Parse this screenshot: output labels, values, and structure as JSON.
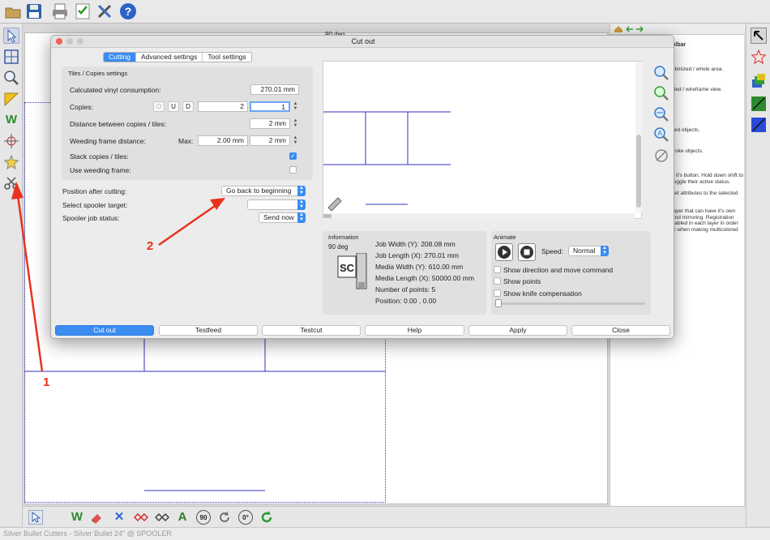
{
  "toolbar": {
    "buttons": [
      "open-icon",
      "save-icon",
      "print-icon",
      "checklist-icon",
      "tools-icon",
      "help-icon"
    ]
  },
  "canvas_label": "90 deg",
  "helppanel": {
    "heading": "olbar",
    "lines": [
      "ptimized / whole area.",
      "illed / wireframe view.",
      "lled objects.",
      "troke objects.",
      "s it's button. Hold down shift to toggle their active status.",
      "set attributes to the selected",
      "layer that can have it's own and mirroring. Registration sabled in each layer in order ic when making multicolored"
    ]
  },
  "dialog": {
    "title": "Cut out",
    "tabs": [
      {
        "label": "Cutting",
        "selected": true
      },
      {
        "label": "Advanced settings",
        "selected": false
      },
      {
        "label": "Tool settings",
        "selected": false
      }
    ],
    "tiles": {
      "heading": "Tiles / Copies settings",
      "consumption_label": "Calculated vinyl consumption:",
      "consumption_value": "270.01 mm",
      "copies_label": "Copies:",
      "copies_buttons": [
        "O",
        "U",
        "D"
      ],
      "copies_x": "2",
      "copies_y": "1",
      "distance_label": "Distance between copies / tiles:",
      "distance_value": "2 mm",
      "weeding_label": "Weeding frame distance:",
      "weeding_max_label": "Max:",
      "weeding_max_value": "2.00 mm",
      "weeding_value": "2 mm",
      "stack_label": "Stack copies / tiles:",
      "stack_checked": true,
      "useweed_label": "Use weeding frame:",
      "useweed_checked": false
    },
    "position_label": "Position after cutting:",
    "position_value": "Go back to beginning",
    "spooler_label": "Select spooler target:",
    "spooler_value": "",
    "jobstatus_label": "Spooler job status:",
    "jobstatus_value": "Send now",
    "information": {
      "heading": "Information",
      "rotation": "90 deg",
      "logo": "SC",
      "lines": [
        "Job Width (Y): 208.08 mm",
        "Job Length (X): 270.01 mm",
        "Media Width (Y): 610.00 mm",
        "Media Length (X): 50000.00 mm",
        "Number of points: 5",
        "Position: 0.00 , 0.00"
      ]
    },
    "animate": {
      "heading": "Animate",
      "speed_label": "Speed:",
      "speed_value": "Normal",
      "options": [
        {
          "label": "Show direction and move command",
          "checked": false
        },
        {
          "label": "Show points",
          "checked": false
        },
        {
          "label": "Show knife compensation",
          "checked": false
        }
      ]
    },
    "buttons": [
      "Cut out",
      "Testfeed",
      "Testcut",
      "Help",
      "Apply",
      "Close"
    ]
  },
  "annotations": {
    "arrow1": "1",
    "arrow2": "2"
  },
  "statusbar": "Silver Bullet Cutters - Silver Bullet 24\" @ SPOOLER",
  "colors": {
    "accent": "#3a8cf0",
    "annotation": "#e8321e",
    "cutline": "#3030c0"
  }
}
